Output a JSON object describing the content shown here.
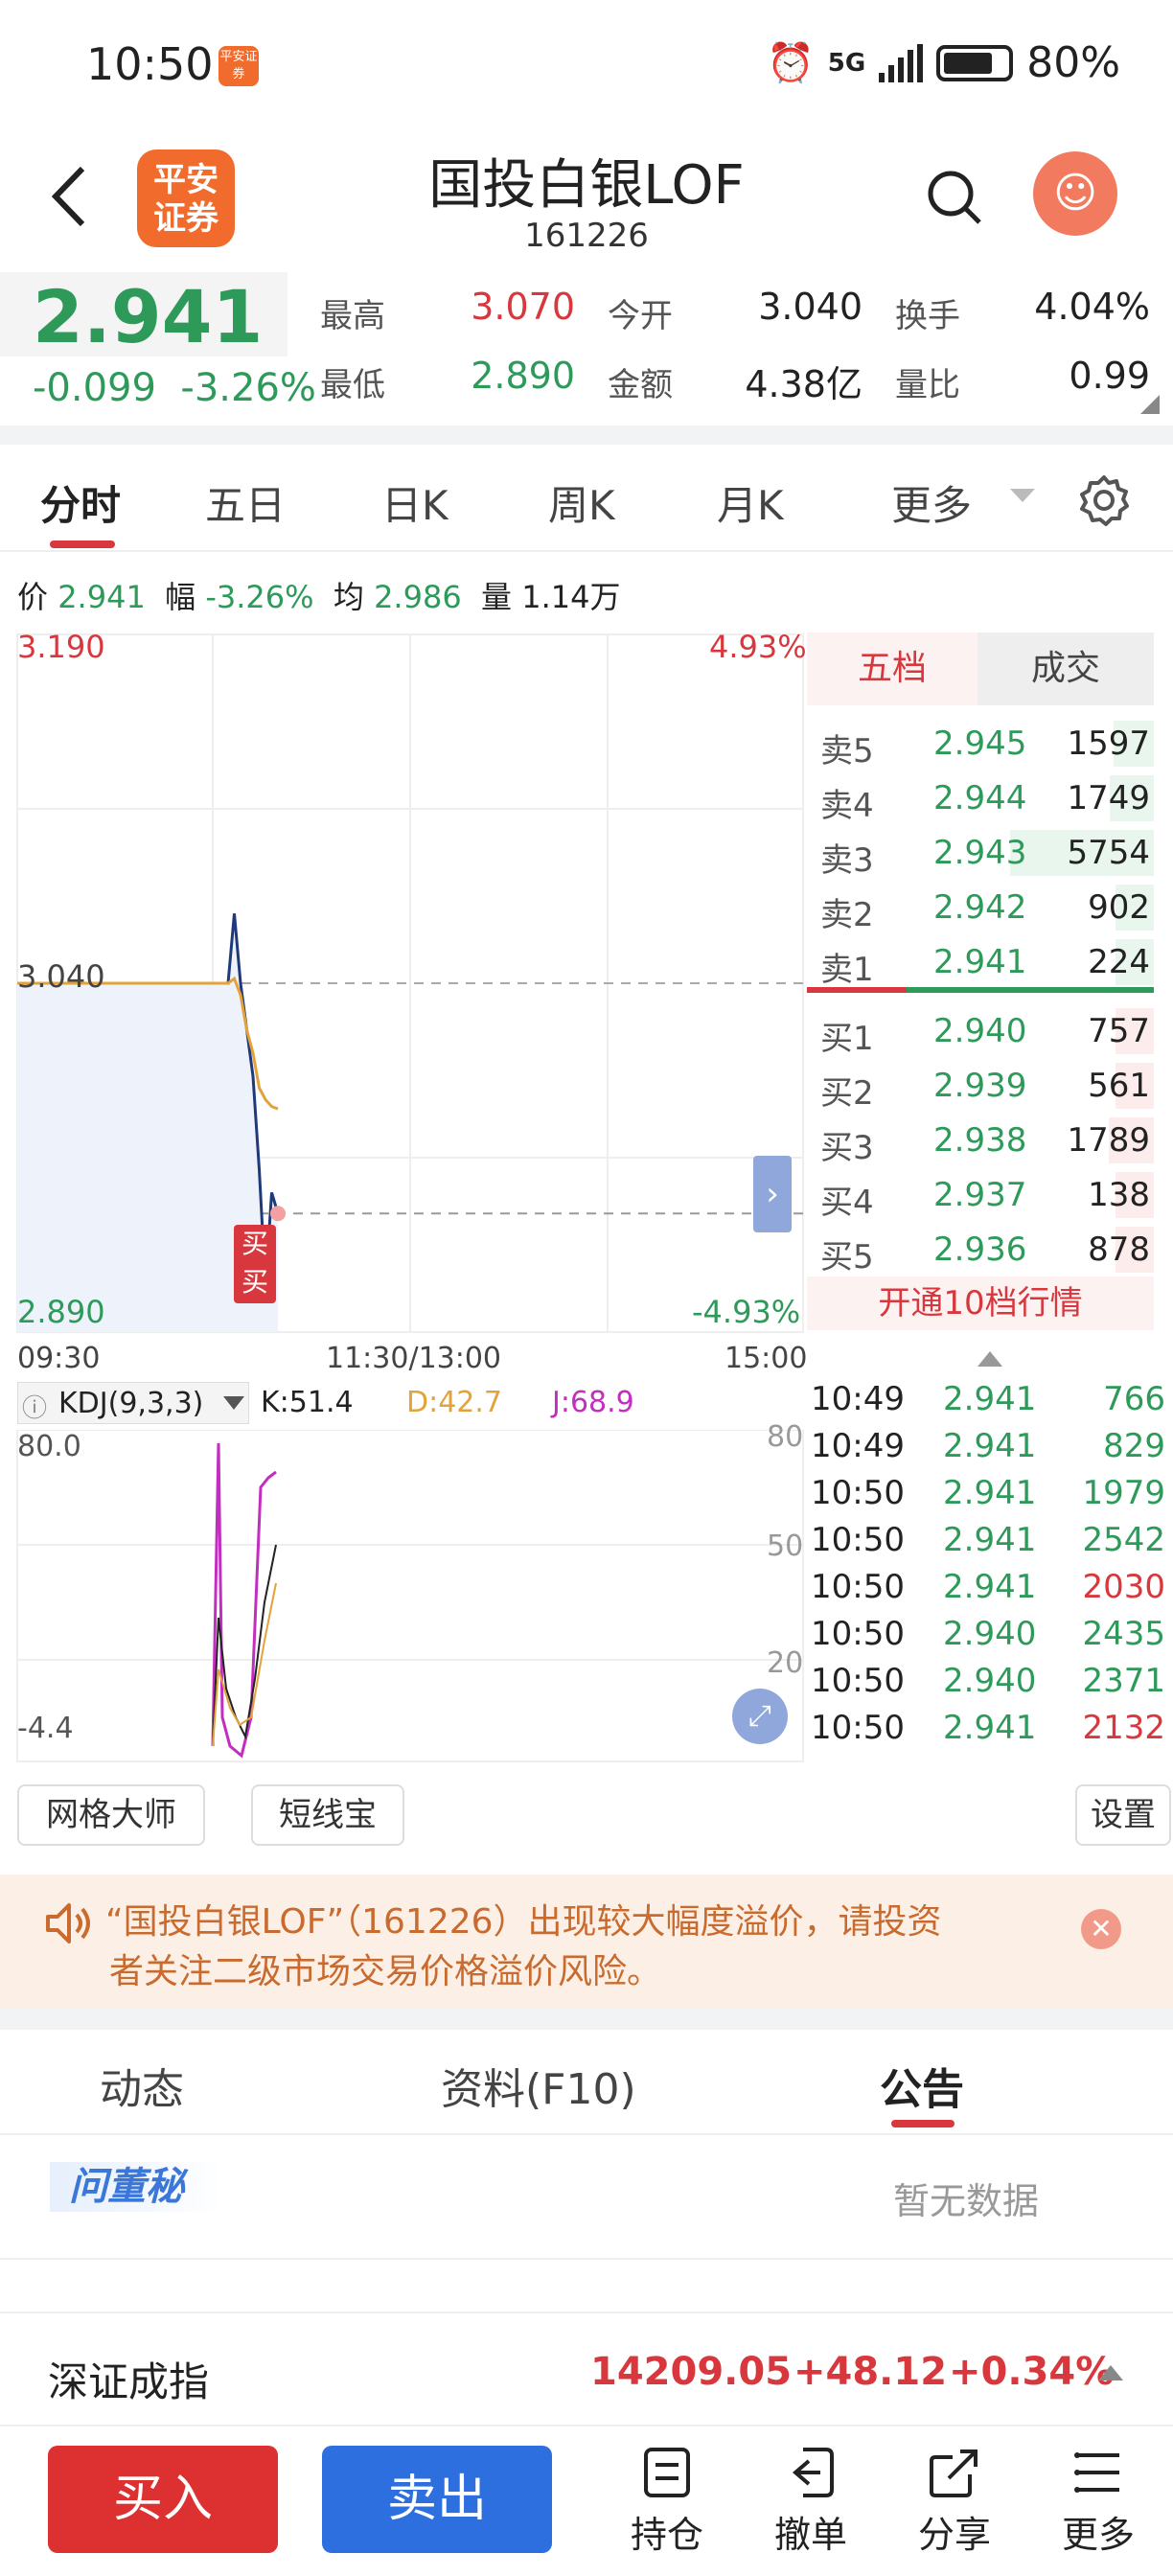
{
  "status": {
    "time": "10:50",
    "badge": "平安证券",
    "network": "5G",
    "battery": "80%"
  },
  "header": {
    "title": "国投白银LOF",
    "code": "161226",
    "logo": "平安\n证券"
  },
  "quote": {
    "price": "2.941",
    "change": "-0.099",
    "change_pct": "-3.26%",
    "fields": [
      {
        "label": "最高",
        "value": "3.070",
        "color": "red"
      },
      {
        "label": "今开",
        "value": "3.040",
        "color": "dark"
      },
      {
        "label": "换手",
        "value": "4.04%",
        "color": "dark"
      },
      {
        "label": "最低",
        "value": "2.890",
        "color": "green"
      },
      {
        "label": "金额",
        "value": "4.38亿",
        "color": "dark"
      },
      {
        "label": "量比",
        "value": "0.99",
        "color": "dark"
      }
    ]
  },
  "tabs": [
    "分时",
    "五日",
    "日K",
    "周K",
    "月K",
    "更多"
  ],
  "info_line": {
    "price_label": "价",
    "price": "2.941",
    "amp_label": "幅",
    "amp": "-3.26%",
    "avg_label": "均",
    "avg": "2.986",
    "vol_label": "量",
    "vol": "1.14万"
  },
  "chart": {
    "y_high": "3.190",
    "y_high_pct": "4.93%",
    "y_open": "3.040",
    "y_low": "2.890",
    "y_low_pct": "-4.93%",
    "x_labels": [
      "09:30",
      "11:30/13:00",
      "15:00"
    ],
    "markers": [
      "买",
      "买"
    ]
  },
  "chart_data": {
    "type": "line",
    "title": "",
    "ylim": [
      2.89,
      3.19
    ],
    "series": [
      {
        "values": [
          3.04,
          3.04,
          3.04,
          3.04,
          3.04,
          3.04,
          3.04,
          3.07,
          3.04,
          3.02,
          3.0,
          2.96,
          2.91,
          2.95,
          2.941
        ]
      },
      {
        "values": [
          3.04,
          3.04,
          3.04,
          3.04,
          3.04,
          3.04,
          3.04,
          3.042,
          3.035,
          3.02,
          3.01,
          2.995,
          2.99,
          2.987,
          2.986
        ]
      }
    ]
  },
  "kdj": {
    "label": "KDJ(9,3,3)",
    "k": "K:51.4",
    "d": "D:42.7",
    "j": "J:68.9",
    "top": "80.0",
    "bottom": "-4.4",
    "r80": "80",
    "r50": "50",
    "r20": "20"
  },
  "book": {
    "tabs": [
      "五档",
      "成交"
    ],
    "asks": [
      {
        "label": "卖5",
        "price": "2.945",
        "vol": "1597"
      },
      {
        "label": "卖4",
        "price": "2.944",
        "vol": "1749"
      },
      {
        "label": "卖3",
        "price": "2.943",
        "vol": "5754"
      },
      {
        "label": "卖2",
        "price": "2.942",
        "vol": "902"
      },
      {
        "label": "卖1",
        "price": "2.941",
        "vol": "224"
      }
    ],
    "bids": [
      {
        "label": "买1",
        "price": "2.940",
        "vol": "757"
      },
      {
        "label": "买2",
        "price": "2.939",
        "vol": "561"
      },
      {
        "label": "买3",
        "price": "2.938",
        "vol": "1789"
      },
      {
        "label": "买4",
        "price": "2.937",
        "vol": "138"
      },
      {
        "label": "买5",
        "price": "2.936",
        "vol": "878"
      }
    ],
    "open10": "开通10档行情"
  },
  "trades": [
    {
      "time": "10:49",
      "price": "2.941",
      "vol": "766",
      "color": "green"
    },
    {
      "time": "10:49",
      "price": "2.941",
      "vol": "829",
      "color": "green"
    },
    {
      "time": "10:50",
      "price": "2.941",
      "vol": "1979",
      "color": "green"
    },
    {
      "time": "10:50",
      "price": "2.941",
      "vol": "2542",
      "color": "green"
    },
    {
      "time": "10:50",
      "price": "2.941",
      "vol": "2030",
      "color": "red"
    },
    {
      "time": "10:50",
      "price": "2.940",
      "vol": "2435",
      "color": "green"
    },
    {
      "time": "10:50",
      "price": "2.940",
      "vol": "2371",
      "color": "green"
    },
    {
      "time": "10:50",
      "price": "2.941",
      "vol": "2132",
      "color": "red"
    }
  ],
  "tools": {
    "grid": "网格大师",
    "short": "短线宝",
    "settings": "设置"
  },
  "notice": {
    "line1": "“国投白银LOF”（161226）出现较大幅度溢价，请投资",
    "line2": "者关注二级市场交易价格溢价风险。"
  },
  "bottom_tabs": [
    "动态",
    "资料(F10)",
    "公告"
  ],
  "wendongmi": "问董秘",
  "nodata": "暂无数据",
  "index": {
    "name": "深证成指",
    "value": "14209.05",
    "change": "+48.12",
    "pct": "+0.34%"
  },
  "actions": {
    "buy": "买入",
    "sell": "卖出",
    "position": "持仓",
    "cancel": "撤单",
    "share": "分享",
    "more": "更多"
  },
  "colors": {
    "red": "#d8383d",
    "green": "#2e9a5a",
    "blue": "#2e6fe0",
    "orange": "#f06b2c"
  }
}
